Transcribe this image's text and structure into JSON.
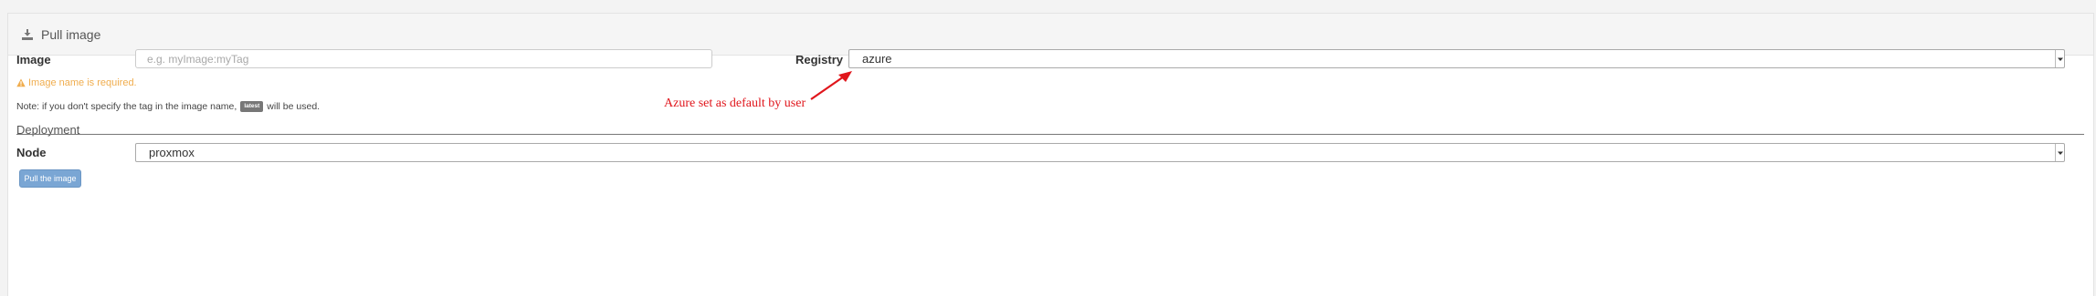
{
  "panel": {
    "title": "Pull image",
    "header_icon": "download-icon"
  },
  "form": {
    "image_label": "Image",
    "image_placeholder": "e.g. myImage:myTag",
    "image_value": "",
    "registry_label": "Registry",
    "registry_value": "azure",
    "warning_text": "Image name is required.",
    "note_prefix": "Note: if you don't specify the tag in the image name,",
    "note_badge": "latest",
    "note_suffix": "will be used."
  },
  "deployment": {
    "section_title": "Deployment",
    "node_label": "Node",
    "node_value": "proxmox"
  },
  "actions": {
    "pull_label": "Pull the image"
  },
  "annotation": {
    "text": "Azure set as default by user",
    "color": "#e0161c"
  },
  "colors": {
    "warning": "#f0ad4e",
    "primary_button": "#7aa6d4"
  }
}
